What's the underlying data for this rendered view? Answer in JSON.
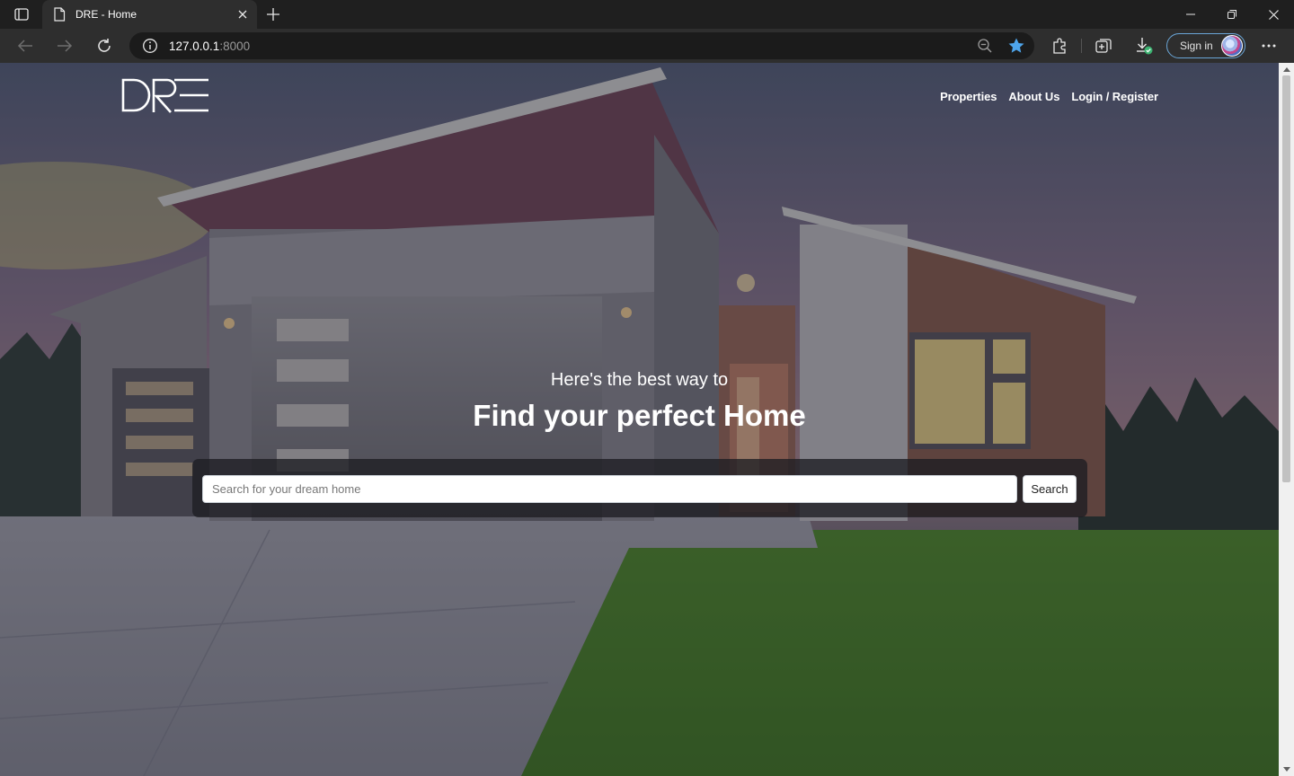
{
  "browser": {
    "tab_title": "DRE - Home",
    "url_host": "127.0.0.1",
    "url_port": ":8000",
    "signin_label": "Sign in"
  },
  "site": {
    "nav": {
      "properties": "Properties",
      "about": "About Us",
      "login": "Login / Register"
    },
    "hero": {
      "lead": "Here's the best way to",
      "headline": "Find your perfect Home"
    },
    "search": {
      "placeholder": "Search for your dream home",
      "button_label": "Search"
    }
  }
}
